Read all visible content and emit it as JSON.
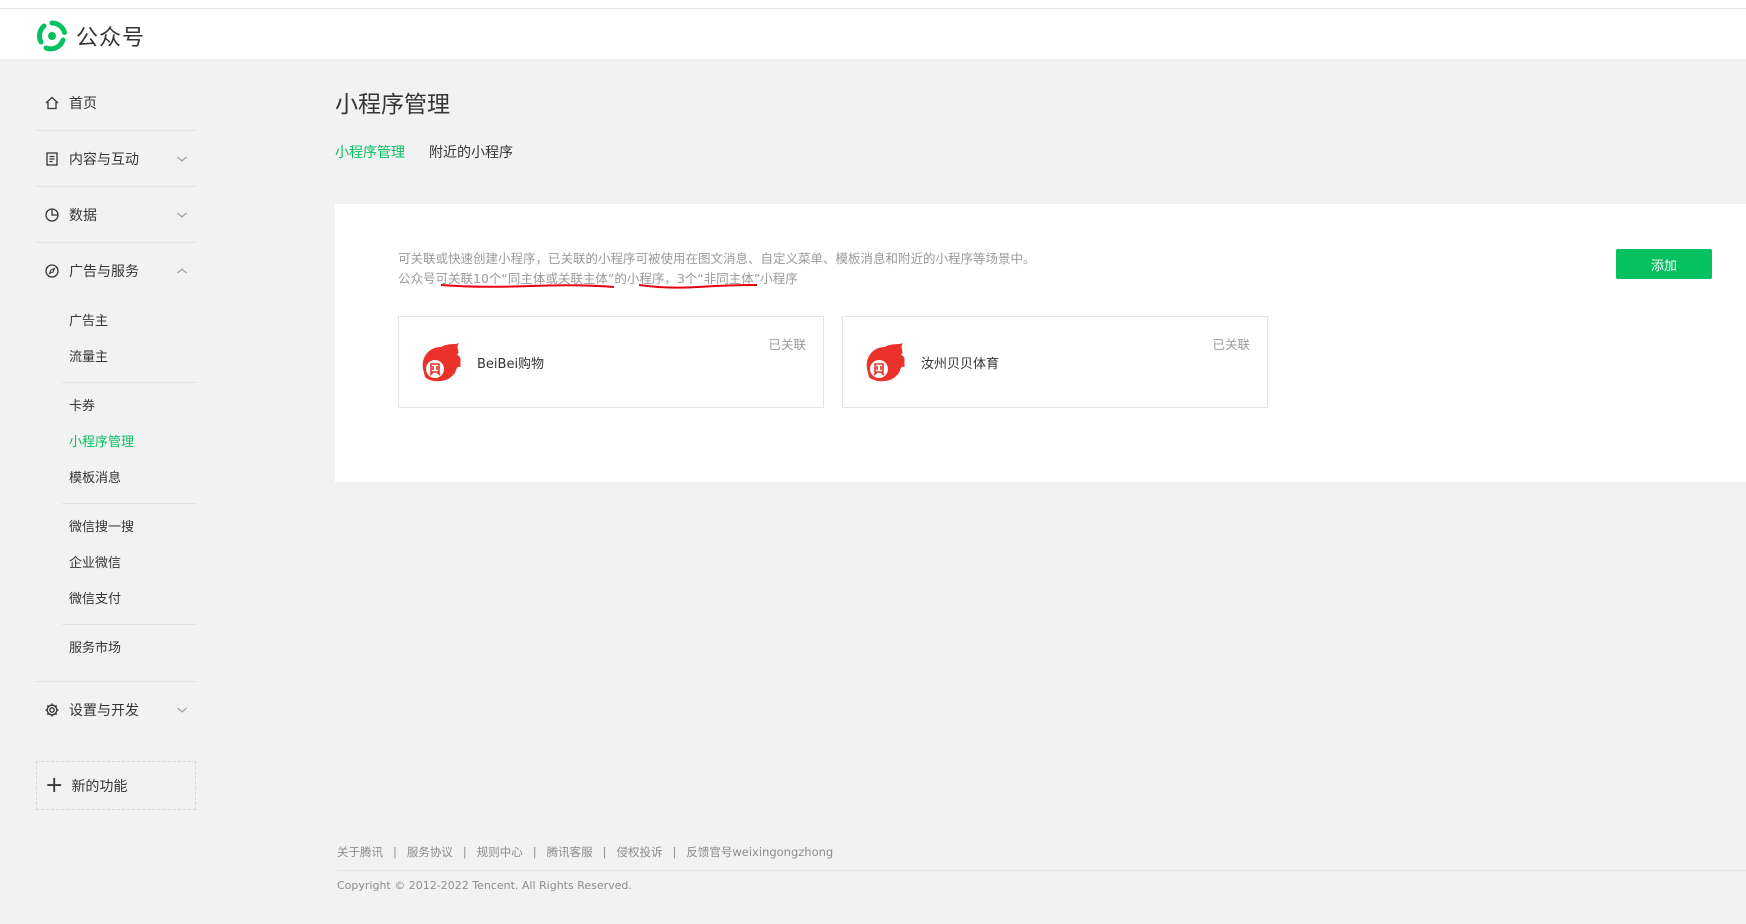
{
  "header": {
    "logo_text": "公众号"
  },
  "sidebar": {
    "home": "首页",
    "content": "内容与互动",
    "data": "数据",
    "ads": "广告与服务",
    "ads_sub": {
      "block1": [
        "广告主",
        "流量主"
      ],
      "block2": [
        "卡券",
        "小程序管理",
        "模板消息"
      ],
      "block3": [
        "微信搜一搜",
        "企业微信",
        "微信支付"
      ],
      "block4": [
        "服务市场"
      ]
    },
    "settings": "设置与开发",
    "new_features": "新的功能"
  },
  "main": {
    "title": "小程序管理",
    "tabs": [
      "小程序管理",
      "附近的小程序"
    ],
    "desc_line1": "可关联或快速创建小程序，已关联的小程序可被使用在图文消息、自定义菜单、模板消息和附近的小程序等场景中。",
    "desc_line2": "公众号可关联10个“同主体或关联主体”的小程序，3个“非同主体”小程序",
    "add_button": "添加",
    "cards": [
      {
        "name": "BeiBei购物",
        "status": "已关联"
      },
      {
        "name": "汝州贝贝体育",
        "status": "已关联"
      }
    ]
  },
  "footer": {
    "links": [
      "关于腾讯",
      "服务协议",
      "规则中心",
      "腾讯客服",
      "侵权投诉",
      "反馈官号weixingongzhong"
    ],
    "copyright": "Copyright © 2012-2022 Tencent. All Rights Reserved."
  },
  "colors": {
    "accent": "#07c160",
    "annotation": "#e60012"
  }
}
